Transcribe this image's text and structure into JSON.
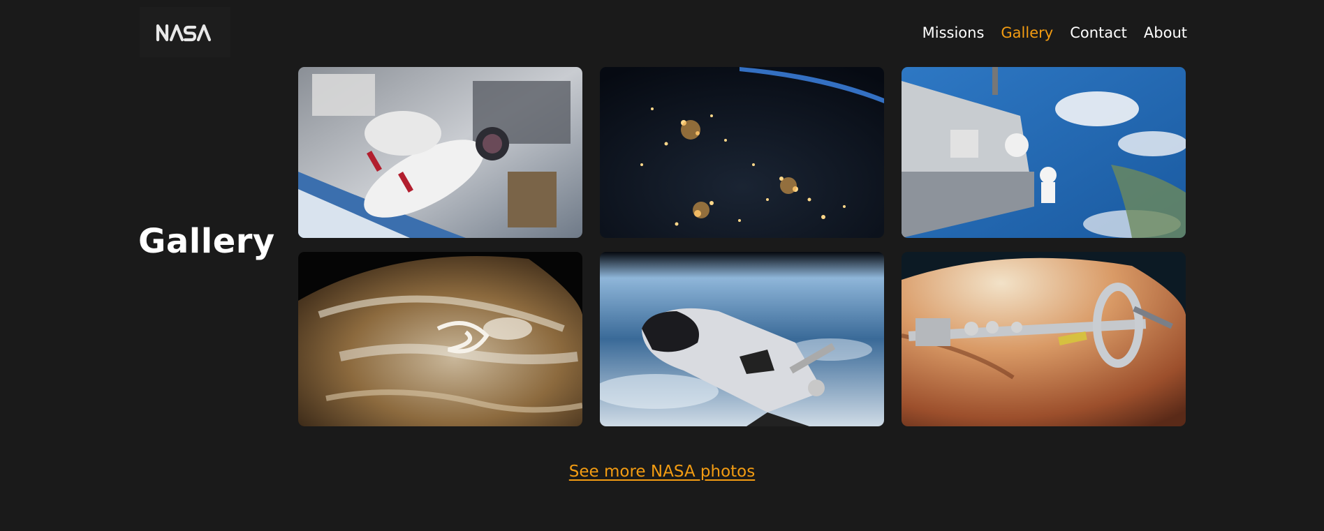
{
  "header": {
    "logo_text": "NASA",
    "nav": [
      {
        "label": "Missions",
        "active": false
      },
      {
        "label": "Gallery",
        "active": true
      },
      {
        "label": "Contact",
        "active": false
      },
      {
        "label": "About",
        "active": false
      }
    ],
    "accent_color": "#f39c12"
  },
  "main": {
    "heading": "Gallery",
    "photos": [
      {
        "icon": "astronaut-spacewalk-photo"
      },
      {
        "icon": "earth-night-lights-photo"
      },
      {
        "icon": "space-station-astronaut-photo"
      },
      {
        "icon": "jupiter-clouds-photo"
      },
      {
        "icon": "space-shuttle-orbit-photo"
      },
      {
        "icon": "mars-spacecraft-photo"
      }
    ],
    "more_link": "See more NASA photos"
  },
  "colors": {
    "background": "#1a1a1a",
    "text": "#ffffff",
    "accent": "#f39c12"
  }
}
